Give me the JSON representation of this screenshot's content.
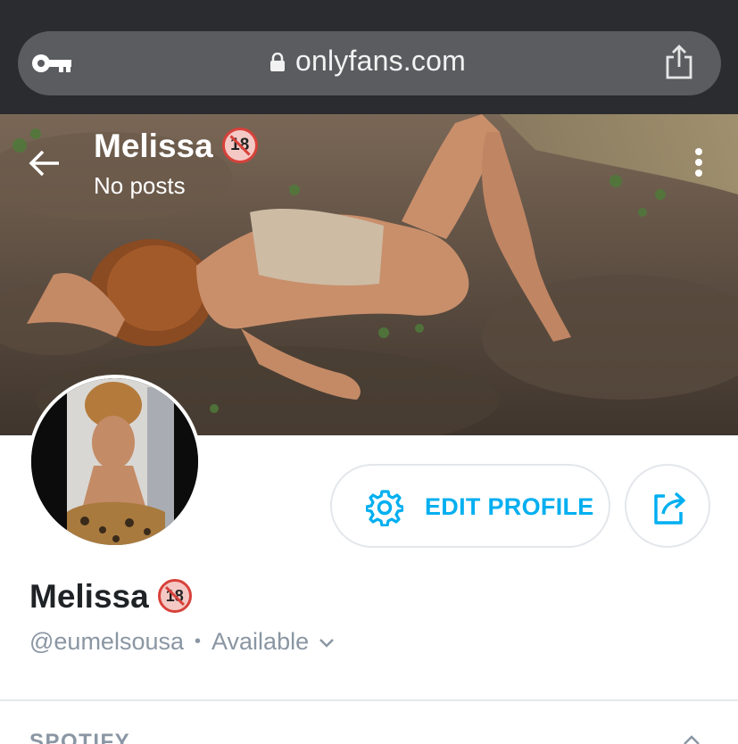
{
  "browser": {
    "url": "onlyfans.com",
    "icons": [
      "key-icon",
      "lock-icon",
      "share-icon"
    ]
  },
  "header": {
    "title": "Melissa",
    "adult_badge": "18",
    "subtitle": "No posts"
  },
  "actions": {
    "edit_profile_label": "EDIT PROFILE"
  },
  "profile": {
    "name": "Melissa",
    "adult_badge": "18",
    "handle": "@eumelsousa",
    "separator": "•",
    "status": "Available"
  },
  "sections": {
    "spotify_title": "SPOTIFY"
  },
  "colors": {
    "accent": "#00aff0",
    "chrome": "#2b2c2f",
    "urlbar": "#5a5c60",
    "muted": "#8a96a3"
  }
}
